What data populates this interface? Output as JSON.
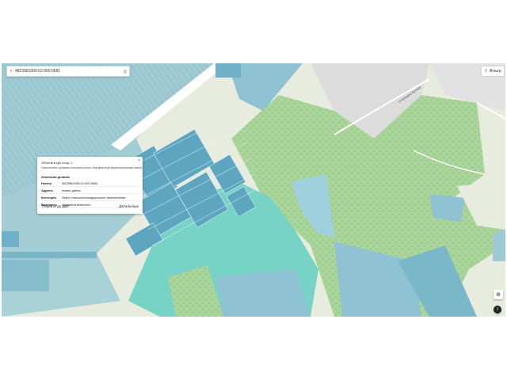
{
  "search": {
    "value": "4823981000:02:000:0681",
    "search_icon": "search-icon",
    "locate_icon": "locate-icon"
  },
  "filter": {
    "label": "Фільтр",
    "icon": "arrow-up-icon"
  },
  "popup": {
    "objects_line": "Об'єктів в цій точці: 1",
    "note": "Натисніть правою кнопкою миші для фіксації вертикальника вікна",
    "section": "Земельна ділянка",
    "rows": [
      {
        "key": "Номер",
        "value": "4823981000:02:000:0681"
      },
      {
        "key": "Адреса",
        "value": "немає даних"
      },
      {
        "key": "Категорія",
        "value": "Землі сільськогосподарського призначення"
      },
      {
        "key": "Власність",
        "value": "Приватна власність"
      }
    ],
    "goto_button": "Перейти до ДЗК",
    "details_button": "Детальніше",
    "close_label": "×"
  },
  "map": {
    "colors": {
      "background": "#e6eae0",
      "parcel": "#9fc9d3",
      "parcel_dark": "#6fb0c0",
      "forest": "#a9d49a",
      "water": "#76d3c6",
      "road": "#ffffff",
      "gray_area": "#dcdcdc"
    },
    "place_label": "Іллінецька вулиця"
  },
  "controls": {
    "locate_button_icon": "crosshair-icon",
    "info_button_icon": "info-icon"
  }
}
